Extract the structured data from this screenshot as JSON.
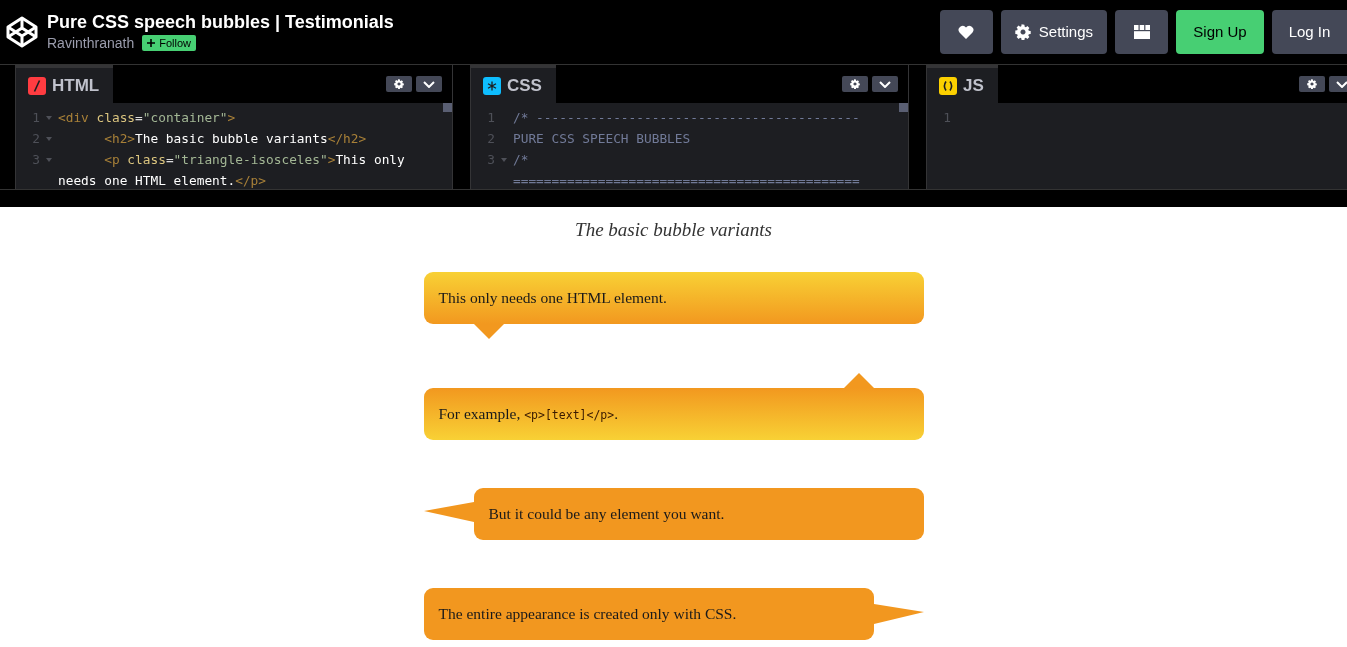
{
  "header": {
    "title": "Pure CSS speech bubbles | Testimonials",
    "author": "Ravinthranath",
    "follow_label": "Follow",
    "buttons": [
      {
        "kind": "heart"
      },
      {
        "kind": "settings",
        "label": "Settings"
      },
      {
        "kind": "layout"
      },
      {
        "kind": "signup",
        "label": "Sign Up"
      },
      {
        "kind": "login",
        "label": "Log In"
      }
    ]
  },
  "editors": [
    {
      "kind": "html",
      "label": "HTML",
      "lines": [
        {
          "number": "1",
          "foldable": true,
          "segments": [
            {
              "kind": "tag",
              "text": "<div "
            },
            {
              "kind": "attr",
              "text": "class"
            },
            {
              "kind": "punct",
              "text": "="
            },
            {
              "kind": "string",
              "text": "\"container\""
            },
            {
              "kind": "tag",
              "text": ">"
            }
          ]
        },
        {
          "number": "2",
          "foldable": true,
          "segments": [
            {
              "kind": "tag",
              "text": "      <h2>"
            },
            {
              "kind": "text",
              "text": "The basic bubble variants"
            },
            {
              "kind": "tag",
              "text": "</h2>"
            }
          ]
        },
        {
          "number": "3",
          "foldable": true,
          "segments": [
            {
              "kind": "tag",
              "text": "      <p "
            },
            {
              "kind": "attr",
              "text": "class"
            },
            {
              "kind": "punct",
              "text": "="
            },
            {
              "kind": "string",
              "text": "\"triangle-isosceles\""
            },
            {
              "kind": "tag",
              "text": ">"
            },
            {
              "kind": "text",
              "text": "This only"
            }
          ]
        },
        {
          "foldable": false,
          "segments": [
            {
              "kind": "text",
              "text": "needs one HTML element."
            },
            {
              "kind": "tag",
              "text": "</p>"
            }
          ]
        }
      ]
    },
    {
      "kind": "css",
      "label": "CSS",
      "lines": [
        {
          "number": "1",
          "foldable": false,
          "segments": [
            {
              "kind": "comment",
              "text": "/* ------------------------------------------"
            }
          ]
        },
        {
          "number": "2",
          "foldable": false,
          "segments": [
            {
              "kind": "comment",
              "text": "PURE CSS SPEECH BUBBLES"
            }
          ]
        },
        {
          "number": "3",
          "foldable": true,
          "segments": [
            {
              "kind": "comment",
              "text": "/*"
            }
          ]
        },
        {
          "foldable": false,
          "segments": [
            {
              "kind": "comment",
              "text": "============================================="
            }
          ]
        }
      ]
    },
    {
      "kind": "js",
      "label": "JS",
      "lines": [
        {
          "number": "1",
          "foldable": false
        }
      ]
    }
  ],
  "preview": {
    "heading": "The basic bubble variants",
    "bubbles": [
      {
        "kind": "bottom-left",
        "segments": [
          {
            "text": "This only needs one HTML element."
          }
        ]
      },
      {
        "kind": "top-right",
        "segments": [
          {
            "text": "For example, "
          },
          {
            "kind": "code",
            "text": "<p>[text]</p>"
          },
          {
            "text": "."
          }
        ]
      },
      {
        "kind": "left",
        "segments": [
          {
            "text": "But it could be any element you want."
          }
        ]
      },
      {
        "kind": "right",
        "segments": [
          {
            "text": "The entire appearance is created only with CSS."
          }
        ]
      }
    ]
  }
}
